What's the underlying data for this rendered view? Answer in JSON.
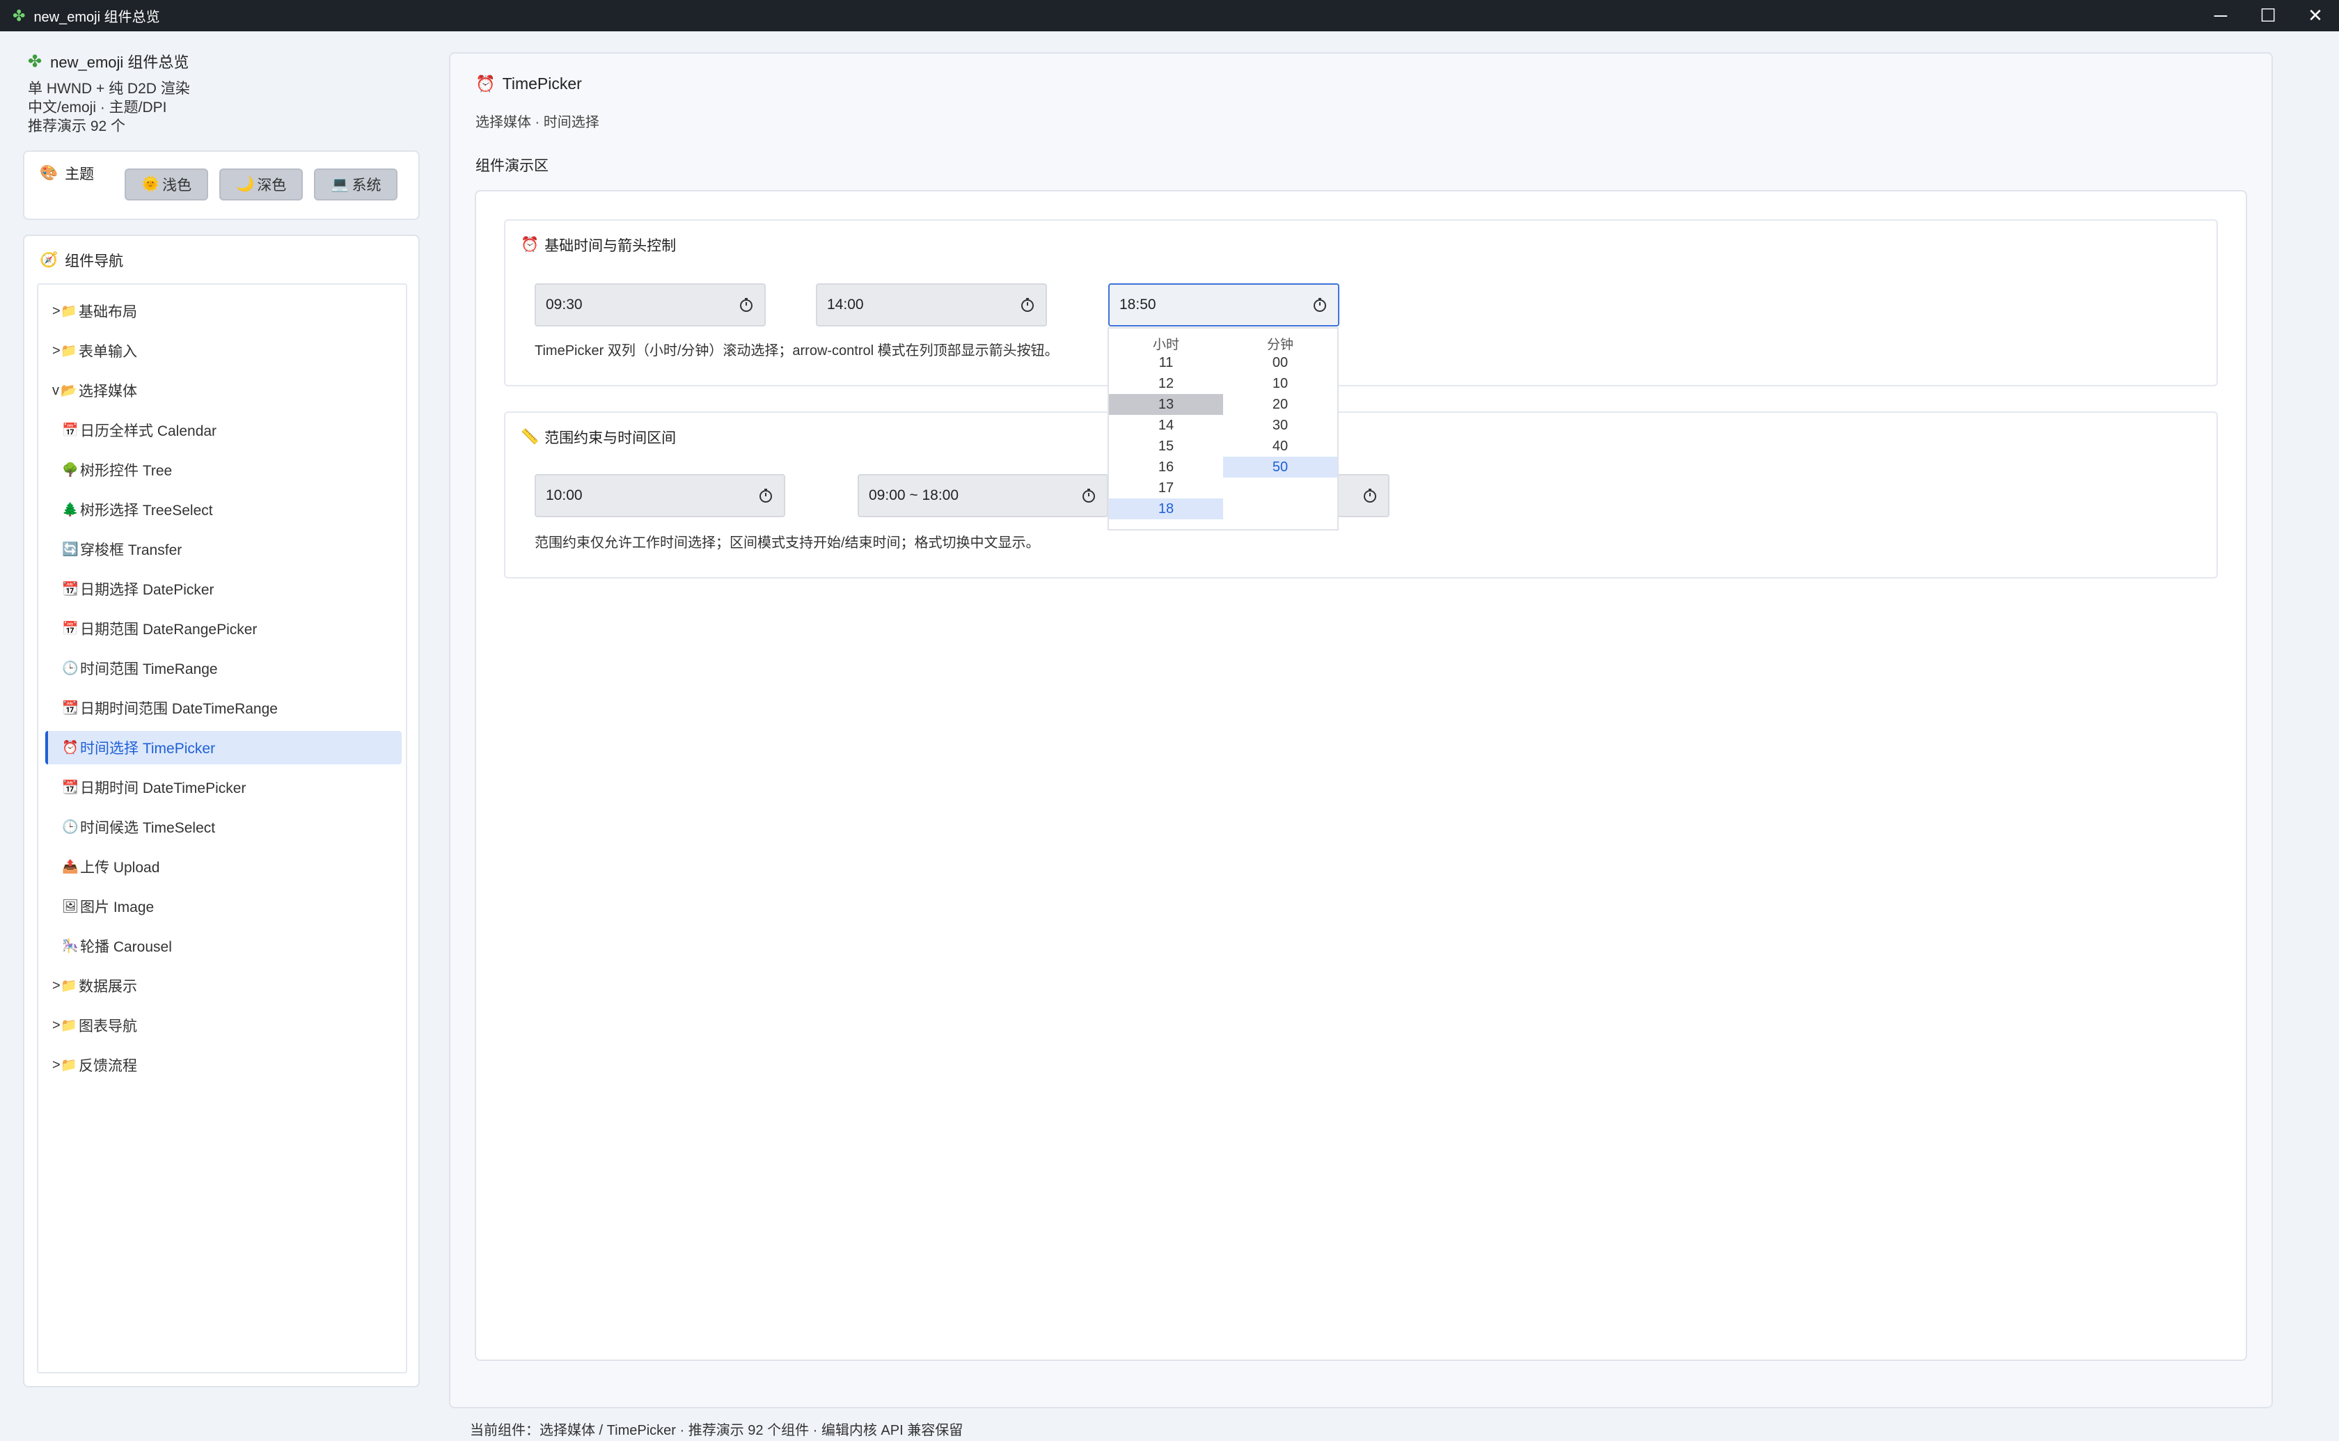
{
  "window": {
    "title": "new_emoji 组件总览",
    "icon": "puzzle-icon",
    "controls": {
      "minimize": "─",
      "maximize": "☐",
      "close": "✕"
    }
  },
  "sidebar": {
    "app_title": "new_emoji 组件总览",
    "subtitle_lines": [
      "单 HWND + 纯 D2D 渲染",
      "中文/emoji · 主题/DPI",
      "推荐演示 92 个"
    ],
    "theme": {
      "label": "主题",
      "buttons": [
        {
          "icon": "🌞",
          "label": "浅色"
        },
        {
          "icon": "🌙",
          "label": "深色"
        },
        {
          "icon": "💻",
          "label": "系统"
        }
      ]
    },
    "nav": {
      "label": "组件导航",
      "items": [
        {
          "kind": "group",
          "chev": ">",
          "icon": "📁",
          "label": "基础布局"
        },
        {
          "kind": "group",
          "chev": ">",
          "icon": "📁",
          "label": "表单输入"
        },
        {
          "kind": "group",
          "chev": "v",
          "icon": "📂",
          "label": "选择媒体"
        },
        {
          "kind": "child",
          "icon": "📅",
          "label": "日历全样式 Calendar"
        },
        {
          "kind": "child",
          "icon": "🌳",
          "label": "树形控件 Tree"
        },
        {
          "kind": "child",
          "icon": "🌲",
          "label": "树形选择 TreeSelect"
        },
        {
          "kind": "child",
          "icon": "🔄",
          "label": "穿梭框 Transfer"
        },
        {
          "kind": "child",
          "icon": "📆",
          "label": "日期选择 DatePicker"
        },
        {
          "kind": "child",
          "icon": "📅",
          "label": "日期范围 DateRangePicker"
        },
        {
          "kind": "child",
          "icon": "🕒",
          "label": "时间范围 TimeRange"
        },
        {
          "kind": "child",
          "icon": "📆",
          "label": "日期时间范围 DateTimeRange"
        },
        {
          "kind": "child",
          "icon": "⏰",
          "label": "时间选择 TimePicker",
          "active": true
        },
        {
          "kind": "child",
          "icon": "📆",
          "label": "日期时间 DateTimePicker"
        },
        {
          "kind": "child",
          "icon": "🕒",
          "label": "时间候选 TimeSelect"
        },
        {
          "kind": "child",
          "icon": "📤",
          "label": "上传 Upload"
        },
        {
          "kind": "child",
          "icon": "🖼",
          "label": "图片 Image"
        },
        {
          "kind": "child",
          "icon": "🎠",
          "label": "轮播 Carousel"
        },
        {
          "kind": "group",
          "chev": ">",
          "icon": "📁",
          "label": "数据展示"
        },
        {
          "kind": "group",
          "chev": ">",
          "icon": "📁",
          "label": "图表导航"
        },
        {
          "kind": "group",
          "chev": ">",
          "icon": "📁",
          "label": "反馈流程"
        }
      ]
    }
  },
  "main": {
    "title": "TimePicker",
    "subtitle": "选择媒体 · 时间选择",
    "demo_label": "组件演示区",
    "section1": {
      "title": "基础时间与箭头控制",
      "fields": [
        "09:30",
        "14:00",
        "18:50"
      ],
      "hint": "TimePicker 双列（小时/分钟）滚动选择；arrow-control 模式在列顶部显示箭头按钮。"
    },
    "section2": {
      "title": "范围约束与时间区间",
      "fields": [
        "10:00",
        "09:00 ~ 18:00"
      ],
      "hint": "范围约束仅允许工作时间选择；区间模式支持开始/结束时间；格式切换中文显示。"
    },
    "dropdown": {
      "hour_header": "小时",
      "minute_header": "分钟",
      "hours": [
        "11",
        "12",
        "13",
        "14",
        "15",
        "16",
        "17",
        "18"
      ],
      "minutes": [
        "00",
        "10",
        "20",
        "30",
        "40",
        "50"
      ],
      "hovered_hour": "13",
      "selected_hour": "18",
      "selected_minute": "50"
    }
  },
  "status": "当前组件：选择媒体 / TimePicker · 推荐演示 92 个组件 · 编辑内核 API 兼容保留"
}
